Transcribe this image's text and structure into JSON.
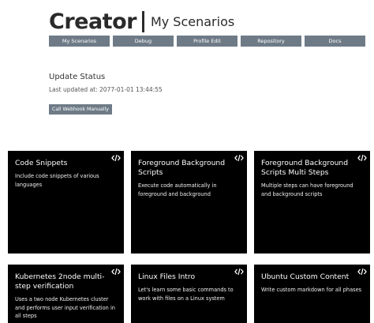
{
  "header": {
    "title": "Creator",
    "subtitle": "My Scenarios"
  },
  "nav": [
    {
      "label": "My Scenarios"
    },
    {
      "label": "Debug"
    },
    {
      "label": "Profile Edit"
    },
    {
      "label": "Repository"
    },
    {
      "label": "Docs"
    }
  ],
  "status": {
    "title": "Update Status",
    "last_updated": "Last updated at: 2077-01-01 13:44:55",
    "webhook_button": "Call Webhook Manually"
  },
  "scenarios": [
    {
      "title": "Code Snippets",
      "description": "Include code snippets of various languages",
      "icon": "code-icon"
    },
    {
      "title": "Foreground Background Scripts",
      "description": "Execute code automatically in foreground and background",
      "icon": "code-icon"
    },
    {
      "title": "Foreground Background Scripts Multi Steps",
      "description": "Multiple steps can have foreground and background scripts",
      "icon": "code-icon"
    },
    {
      "title": "Kubernetes 2node multi-step verification",
      "description": "Uses a two node Kubernetes cluster and performs user input verification in all steps",
      "icon": "code-icon"
    },
    {
      "title": "Linux Files Intro",
      "description": "Let's learn some basic commands to work with files on a Linux system",
      "icon": "code-icon"
    },
    {
      "title": "Ubuntu Custom Content",
      "description": "Write custom markdown for all phases",
      "icon": "code-icon"
    }
  ],
  "colors": {
    "nav_button": "#6e7b87",
    "card_background": "#000000",
    "card_text": "#ffffff"
  }
}
